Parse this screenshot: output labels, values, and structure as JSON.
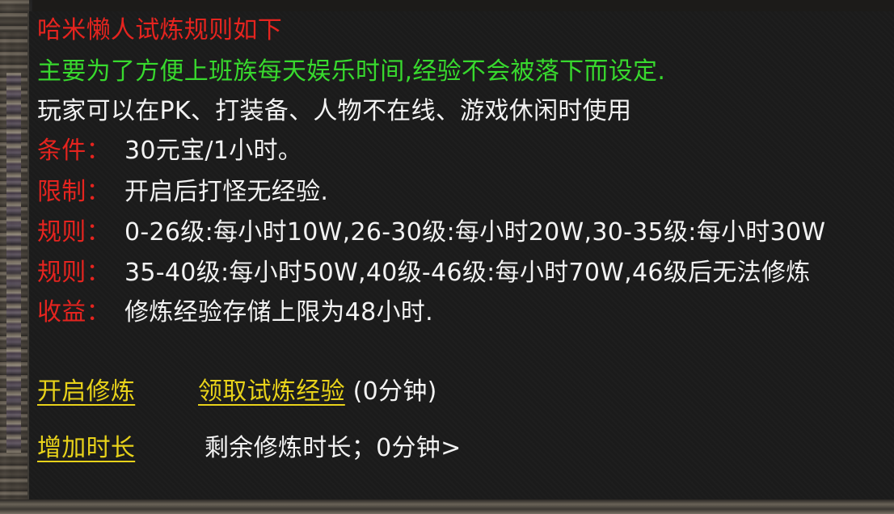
{
  "title": "哈米懒人试炼规则如下",
  "subtitle": "主要为了方便上班族每天娱乐时间,经验不会被落下而设定.",
  "usage": "玩家可以在PK、打装备、人物不在线、游戏休闲时使用",
  "rules": [
    {
      "label": "条件：",
      "text": "30元宝/1小时。"
    },
    {
      "label": "限制：",
      "text": "开启后打怪无经验."
    },
    {
      "label": "规则：",
      "text": "0-26级:每小时10W,26-30级:每小时20W,30-35级:每小时30W"
    },
    {
      "label": "规则：",
      "text": "35-40级:每小时50W,40级-46级:每小时70W,46级后无法修炼"
    },
    {
      "label": "收益：",
      "text": "修炼经验存储上限为48小时."
    }
  ],
  "actions": {
    "start_training": "开启修炼",
    "claim_exp": "领取试炼经验",
    "claim_exp_status": "(0分钟)",
    "add_time": "增加时长",
    "remaining_time": "剩余修炼时长；0分钟>"
  },
  "colors": {
    "title": "#e5241f",
    "subtitle": "#38d92e",
    "body": "#f2f2f2",
    "label": "#e5241f",
    "link": "#e8d21a",
    "panel_bg": "#1b1b1b"
  }
}
